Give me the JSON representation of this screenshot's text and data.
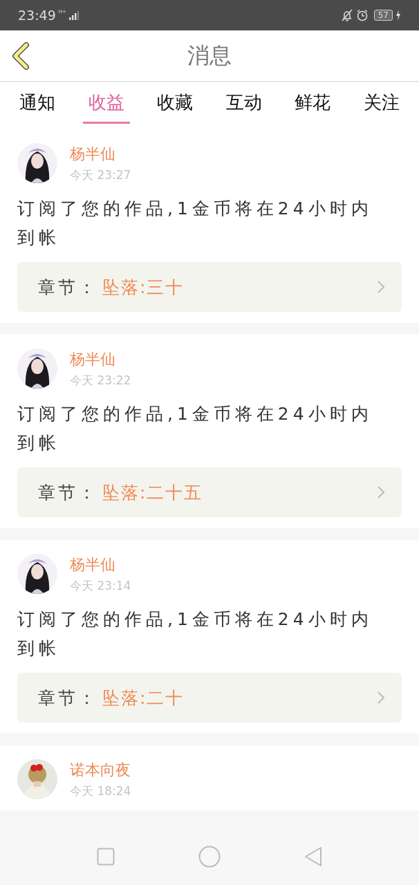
{
  "status_bar": {
    "time": "23:49",
    "network": "H+",
    "battery": "57"
  },
  "header": {
    "title": "消息"
  },
  "tabs": [
    {
      "label": "通知",
      "selected": false
    },
    {
      "label": "收益",
      "selected": true
    },
    {
      "label": "收藏",
      "selected": false
    },
    {
      "label": "互动",
      "selected": false
    },
    {
      "label": "鲜花",
      "selected": false
    },
    {
      "label": "关注",
      "selected": false
    }
  ],
  "messages": [
    {
      "name": "杨半仙",
      "time": "今天 23:27",
      "text": "订阅了您的作品,1金币将在24小时内到帐",
      "chapter_label": "章节：",
      "chapter": "坠落:三十"
    },
    {
      "name": "杨半仙",
      "time": "今天 23:22",
      "text": "订阅了您的作品,1金币将在24小时内到帐",
      "chapter_label": "章节：",
      "chapter": "坠落:二十五"
    },
    {
      "name": "杨半仙",
      "time": "今天 23:14",
      "text": "订阅了您的作品,1金币将在24小时内到帐",
      "chapter_label": "章节：",
      "chapter": "坠落:二十"
    },
    {
      "name": "诺本向夜",
      "time": "今天 18:24"
    }
  ]
}
